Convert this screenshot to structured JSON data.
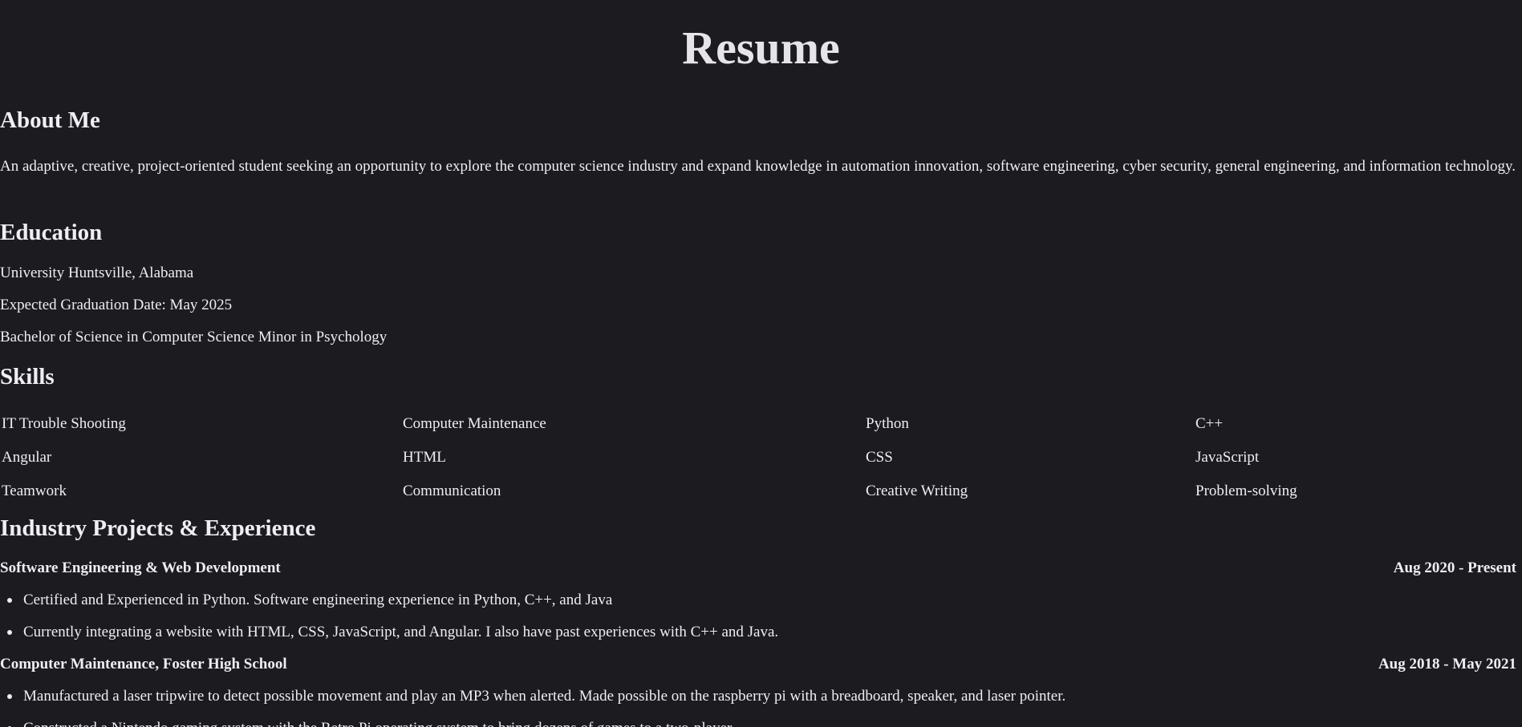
{
  "page": {
    "title": "Resume",
    "background": "#1c1b1f",
    "text_color": "#f0eef2"
  },
  "about": {
    "heading": "About Me",
    "text": "An adaptive, creative, project-oriented student seeking an opportunity to explore the computer science industry and expand knowledge in automation innovation, software engineering, cyber security, general engineering, and information technology."
  },
  "education": {
    "heading": "Education",
    "lines": [
      "University Huntsville, Alabama",
      "Expected Graduation Date: May 2025",
      "Bachelor of Science in Computer Science Minor in Psychology"
    ]
  },
  "skills": {
    "heading": "Skills",
    "rows": [
      [
        "IT Trouble Shooting",
        "Computer Maintenance",
        "Python",
        "C++"
      ],
      [
        "Angular",
        "HTML",
        "CSS",
        "JavaScript"
      ],
      [
        "Teamwork",
        "Communication",
        "Creative Writing",
        "Problem-solving"
      ]
    ]
  },
  "experience": {
    "heading": "Industry Projects & Experience",
    "items": [
      {
        "title": "Software Engineering & Web Development",
        "dates": "Aug 2020 - Present",
        "bullets": [
          "Certified and Experienced in Python. Software engineering experience in Python, C++, and Java",
          "Currently integrating a website with HTML, CSS, JavaScript, and Angular. I also have past experiences with C++ and Java."
        ]
      },
      {
        "title": "Computer Maintenance, Foster High School",
        "dates": "Aug 2018 - May 2021",
        "bullets": [
          "Manufactured a laser tripwire to detect possible movement and play an MP3 when alerted. Made possible on the raspberry pi with a breadboard, speaker, and laser pointer.",
          "Constructed a Nintendo gaming system with the Retro Pi operating system to bring dozens of games to a two-player"
        ]
      }
    ]
  }
}
